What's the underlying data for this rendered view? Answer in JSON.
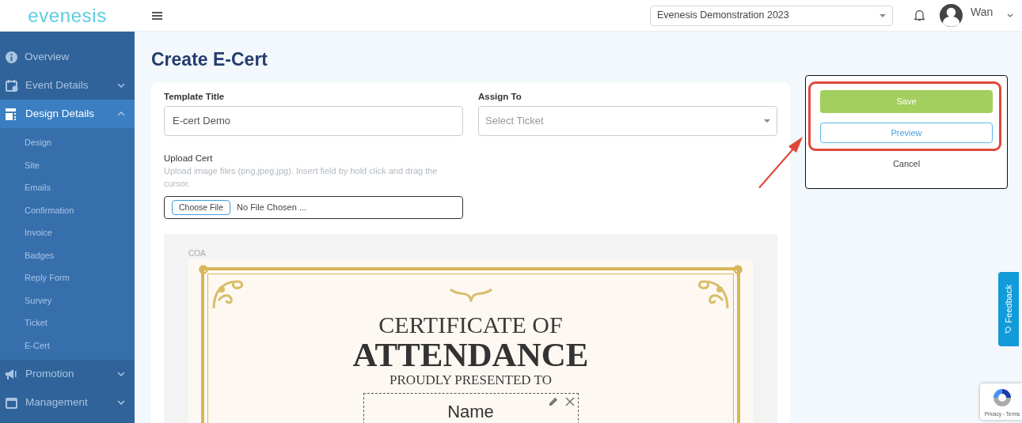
{
  "header": {
    "logo": "evenesis",
    "event_select": "Evenesis Demonstration 2023",
    "user": "Wan"
  },
  "sidebar": {
    "items": [
      {
        "label": "Overview",
        "kind": "link",
        "selected": false
      },
      {
        "label": "Event Details",
        "kind": "group",
        "expanded": false,
        "selected": false
      },
      {
        "label": "Design Details",
        "kind": "group",
        "expanded": true,
        "selected": true,
        "children": [
          {
            "label": "Design",
            "selected": false
          },
          {
            "label": "Site",
            "selected": false
          },
          {
            "label": "Emails",
            "selected": false
          },
          {
            "label": "Confirmation",
            "selected": false
          },
          {
            "label": "Invoice",
            "selected": false
          },
          {
            "label": "Badges",
            "selected": false
          },
          {
            "label": "Reply Form",
            "selected": false
          },
          {
            "label": "Survey",
            "selected": false
          },
          {
            "label": "Ticket",
            "selected": false
          },
          {
            "label": "E-Cert",
            "selected": false
          }
        ]
      },
      {
        "label": "Promotion",
        "kind": "group",
        "expanded": false,
        "selected": false
      },
      {
        "label": "Management",
        "kind": "group",
        "expanded": false,
        "selected": false
      }
    ]
  },
  "page_title": "Create E-Cert",
  "form": {
    "template_title": {
      "label": "Template Title",
      "value": "E-cert Demo"
    },
    "assign_to": {
      "label": "Assign To",
      "placeholder": "Select Ticket"
    },
    "upload_cert": {
      "label": "Upload Cert",
      "hint": "Upload image files (png,jpeg,jpg). Insert field by hold click and drag the cursor.",
      "button": "Choose File",
      "file_name": "No File Chosen ..."
    }
  },
  "certificate": {
    "label": "COA",
    "line1": "CERTIFICATE OF",
    "line2": "ATTENDANCE",
    "line3": "PROUDLY PRESENTED TO",
    "name_field": "Name"
  },
  "actions": {
    "save": "Save",
    "preview": "Preview",
    "cancel": "Cancel"
  },
  "feedback": "Feedback",
  "recaptcha": "Privacy - Terms"
}
